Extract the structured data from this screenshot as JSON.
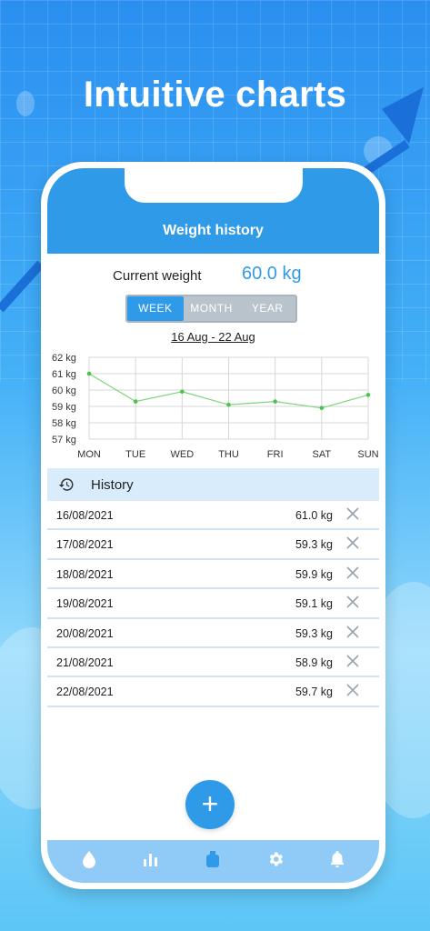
{
  "headline": "Intuitive charts",
  "header": {
    "title": "Weight history"
  },
  "current": {
    "label": "Current weight",
    "value": "60.0 kg"
  },
  "segments": [
    "WEEK",
    "MONTH",
    "YEAR"
  ],
  "active_segment": "WEEK",
  "date_range": "16 Aug - 22 Aug",
  "history_title": "History",
  "history": [
    {
      "date": "16/08/2021",
      "weight": "61.0 kg"
    },
    {
      "date": "17/08/2021",
      "weight": "59.3 kg"
    },
    {
      "date": "18/08/2021",
      "weight": "59.9 kg"
    },
    {
      "date": "19/08/2021",
      "weight": "59.1 kg"
    },
    {
      "date": "20/08/2021",
      "weight": "59.3 kg"
    },
    {
      "date": "21/08/2021",
      "weight": "58.9 kg"
    },
    {
      "date": "22/08/2021",
      "weight": "59.7 kg"
    }
  ],
  "fab_label": "+",
  "tabs": [
    "water-drop-icon",
    "bar-chart-icon",
    "weight-icon",
    "settings-icon",
    "bell-icon"
  ],
  "colors": {
    "accent": "#2f9be8",
    "line": "#7ed47e"
  },
  "chart_data": {
    "type": "line",
    "categories": [
      "MON",
      "TUE",
      "WED",
      "THU",
      "FRI",
      "SAT",
      "SUN"
    ],
    "values": [
      61.0,
      59.3,
      59.9,
      59.1,
      59.3,
      58.9,
      59.7
    ],
    "yticks": [
      "62 kg",
      "61 kg",
      "60 kg",
      "59 kg",
      "58 kg",
      "57 kg"
    ],
    "ylim": [
      57,
      62
    ],
    "grid": true
  }
}
